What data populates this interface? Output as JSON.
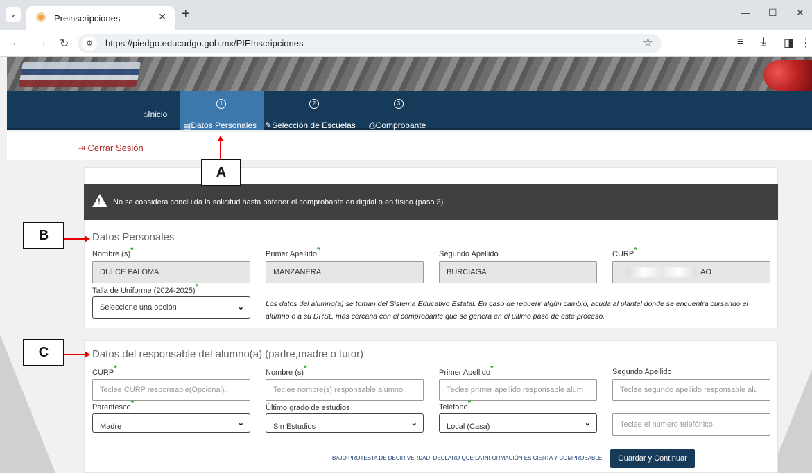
{
  "browser": {
    "tab_title": "Preinscripciones",
    "url": "https://piedgo.educadgo.gob.mx/PIEInscripciones"
  },
  "nav": {
    "home_label": "Inicio",
    "steps": [
      {
        "number": "1",
        "label": "Datos Personales"
      },
      {
        "number": "2",
        "label": "Selección de Escuelas"
      },
      {
        "number": "3",
        "label": "Comprobante"
      }
    ]
  },
  "logout_label": "Cerrar Sesión",
  "alert_text": "No se considera concluida la solicitud hasta obtener el comprobante en digital o en físico (paso 3).",
  "personal": {
    "title": "Datos Personales",
    "labels": {
      "nombre": "Nombre (s)",
      "primer_apellido": "Primer Apellido",
      "segundo_apellido": "Segundo Apellido",
      "curp": "CURP",
      "talla": "Talla de Uniforme (2024-2025)"
    },
    "values": {
      "nombre": "DULCE PALOMA",
      "primer_apellido": "MANZANERA",
      "segundo_apellido": "BURCIAGA",
      "curp_suffix": "AO",
      "talla": "Seleccione una opción"
    },
    "note": "Los datos del alumno(a) se toman del Sistema Educativo Estatal. En caso de requerir algún cambio, acuda al plantel donde se encuentra cursando el alumno o a su DRSE más cercana con el comprobante que se genera en el último paso de este proceso."
  },
  "responsible": {
    "title": "Datos del responsable del alumno(a) (padre,madre o tutor)",
    "labels": {
      "curp": "CURP",
      "nombre": "Nombre (s)",
      "primer_apellido": "Primer Apellido",
      "segundo_apellido": "Segundo Apellido",
      "parentesco": "Parentesco",
      "grado": "Último grado de estudios",
      "telefono": "Teléfono"
    },
    "placeholders": {
      "curp": "Teclee CURP responsable(Opcional).",
      "nombre": "Teclee nombre(s) responsable alumno.",
      "primer_apellido": "Teclee primer apellido responsable alum",
      "segundo_apellido": "Teclee segundo apellido responsable alu",
      "numero": "Teclee el número telefónico."
    },
    "selects": {
      "parentesco": "Madre",
      "grado": "Sin Estudios",
      "telefono": "Local (Casa)"
    }
  },
  "declaration": "BAJO PROTESTA DE DECIR VERDAD, DECLARO QUE LA INFORMACIÓN ES CIERTA Y COMPROBABLE",
  "save_label": "Guardar y Continuar",
  "callouts": {
    "a": "A",
    "b": "B",
    "c": "C"
  },
  "colors": {
    "navbar": "#163a5a",
    "active_step": "#3d78ad",
    "required": "#3cb043",
    "arrow": "#e00000"
  }
}
